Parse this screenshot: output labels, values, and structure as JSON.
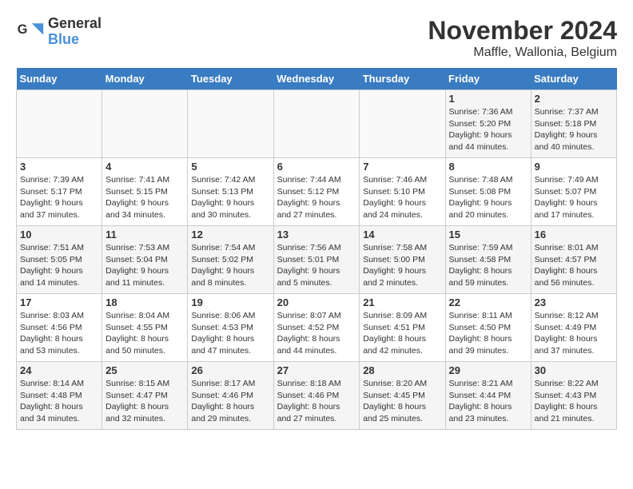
{
  "header": {
    "logo": {
      "line1": "General",
      "line2": "Blue"
    },
    "title": "November 2024",
    "subtitle": "Maffle, Wallonia, Belgium"
  },
  "days_of_week": [
    "Sunday",
    "Monday",
    "Tuesday",
    "Wednesday",
    "Thursday",
    "Friday",
    "Saturday"
  ],
  "weeks": [
    [
      {
        "day": "",
        "info": ""
      },
      {
        "day": "",
        "info": ""
      },
      {
        "day": "",
        "info": ""
      },
      {
        "day": "",
        "info": ""
      },
      {
        "day": "",
        "info": ""
      },
      {
        "day": "1",
        "info": "Sunrise: 7:36 AM\nSunset: 5:20 PM\nDaylight: 9 hours and 44 minutes."
      },
      {
        "day": "2",
        "info": "Sunrise: 7:37 AM\nSunset: 5:18 PM\nDaylight: 9 hours and 40 minutes."
      }
    ],
    [
      {
        "day": "3",
        "info": "Sunrise: 7:39 AM\nSunset: 5:17 PM\nDaylight: 9 hours and 37 minutes."
      },
      {
        "day": "4",
        "info": "Sunrise: 7:41 AM\nSunset: 5:15 PM\nDaylight: 9 hours and 34 minutes."
      },
      {
        "day": "5",
        "info": "Sunrise: 7:42 AM\nSunset: 5:13 PM\nDaylight: 9 hours and 30 minutes."
      },
      {
        "day": "6",
        "info": "Sunrise: 7:44 AM\nSunset: 5:12 PM\nDaylight: 9 hours and 27 minutes."
      },
      {
        "day": "7",
        "info": "Sunrise: 7:46 AM\nSunset: 5:10 PM\nDaylight: 9 hours and 24 minutes."
      },
      {
        "day": "8",
        "info": "Sunrise: 7:48 AM\nSunset: 5:08 PM\nDaylight: 9 hours and 20 minutes."
      },
      {
        "day": "9",
        "info": "Sunrise: 7:49 AM\nSunset: 5:07 PM\nDaylight: 9 hours and 17 minutes."
      }
    ],
    [
      {
        "day": "10",
        "info": "Sunrise: 7:51 AM\nSunset: 5:05 PM\nDaylight: 9 hours and 14 minutes."
      },
      {
        "day": "11",
        "info": "Sunrise: 7:53 AM\nSunset: 5:04 PM\nDaylight: 9 hours and 11 minutes."
      },
      {
        "day": "12",
        "info": "Sunrise: 7:54 AM\nSunset: 5:02 PM\nDaylight: 9 hours and 8 minutes."
      },
      {
        "day": "13",
        "info": "Sunrise: 7:56 AM\nSunset: 5:01 PM\nDaylight: 9 hours and 5 minutes."
      },
      {
        "day": "14",
        "info": "Sunrise: 7:58 AM\nSunset: 5:00 PM\nDaylight: 9 hours and 2 minutes."
      },
      {
        "day": "15",
        "info": "Sunrise: 7:59 AM\nSunset: 4:58 PM\nDaylight: 8 hours and 59 minutes."
      },
      {
        "day": "16",
        "info": "Sunrise: 8:01 AM\nSunset: 4:57 PM\nDaylight: 8 hours and 56 minutes."
      }
    ],
    [
      {
        "day": "17",
        "info": "Sunrise: 8:03 AM\nSunset: 4:56 PM\nDaylight: 8 hours and 53 minutes."
      },
      {
        "day": "18",
        "info": "Sunrise: 8:04 AM\nSunset: 4:55 PM\nDaylight: 8 hours and 50 minutes."
      },
      {
        "day": "19",
        "info": "Sunrise: 8:06 AM\nSunset: 4:53 PM\nDaylight: 8 hours and 47 minutes."
      },
      {
        "day": "20",
        "info": "Sunrise: 8:07 AM\nSunset: 4:52 PM\nDaylight: 8 hours and 44 minutes."
      },
      {
        "day": "21",
        "info": "Sunrise: 8:09 AM\nSunset: 4:51 PM\nDaylight: 8 hours and 42 minutes."
      },
      {
        "day": "22",
        "info": "Sunrise: 8:11 AM\nSunset: 4:50 PM\nDaylight: 8 hours and 39 minutes."
      },
      {
        "day": "23",
        "info": "Sunrise: 8:12 AM\nSunset: 4:49 PM\nDaylight: 8 hours and 37 minutes."
      }
    ],
    [
      {
        "day": "24",
        "info": "Sunrise: 8:14 AM\nSunset: 4:48 PM\nDaylight: 8 hours and 34 minutes."
      },
      {
        "day": "25",
        "info": "Sunrise: 8:15 AM\nSunset: 4:47 PM\nDaylight: 8 hours and 32 minutes."
      },
      {
        "day": "26",
        "info": "Sunrise: 8:17 AM\nSunset: 4:46 PM\nDaylight: 8 hours and 29 minutes."
      },
      {
        "day": "27",
        "info": "Sunrise: 8:18 AM\nSunset: 4:46 PM\nDaylight: 8 hours and 27 minutes."
      },
      {
        "day": "28",
        "info": "Sunrise: 8:20 AM\nSunset: 4:45 PM\nDaylight: 8 hours and 25 minutes."
      },
      {
        "day": "29",
        "info": "Sunrise: 8:21 AM\nSunset: 4:44 PM\nDaylight: 8 hours and 23 minutes."
      },
      {
        "day": "30",
        "info": "Sunrise: 8:22 AM\nSunset: 4:43 PM\nDaylight: 8 hours and 21 minutes."
      }
    ]
  ]
}
